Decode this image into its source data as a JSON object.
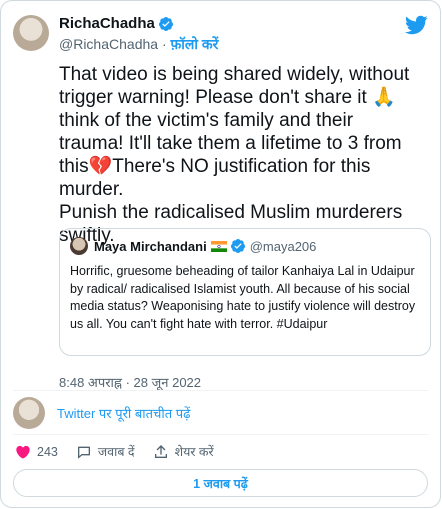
{
  "author": {
    "name": "RichaChadha",
    "handle": "@RichaChadha",
    "separator": "·",
    "follow_label": "फ़ॉलो करें"
  },
  "tweet": {
    "text": "That video is being shared widely, without trigger warning! Please  don't share it 🙏think of the victim's family and their trauma! It'll take them a lifetime to 3 from this💔There's NO justification for this murder.\nPunish the radicalised Muslim murderers swiftly."
  },
  "quote": {
    "name": "Maya Mirchandani",
    "handle": "@maya206",
    "text": "Horrific, gruesome beheading of tailor Kanhaiya Lal in Udaipur by radical/ radicalised Islamist youth. All because of his social media status? Weaponising hate to justify violence will destroy us all. You can't fight hate with terror. #Udaipur"
  },
  "timestamp": "8:48 अपराह्न · 28 जून 2022",
  "conversation_link": "Twitter पर पूरी बातचीत पढ़ें",
  "actions": {
    "likes_count": "243",
    "reply_label": "जवाब दें",
    "share_label": "शेयर करें"
  },
  "replies_button": "1 जवाब पढ़ें",
  "colors": {
    "accent": "#1d9bf0",
    "heart": "#f91880",
    "text": "#0f1419",
    "muted": "#536471"
  }
}
